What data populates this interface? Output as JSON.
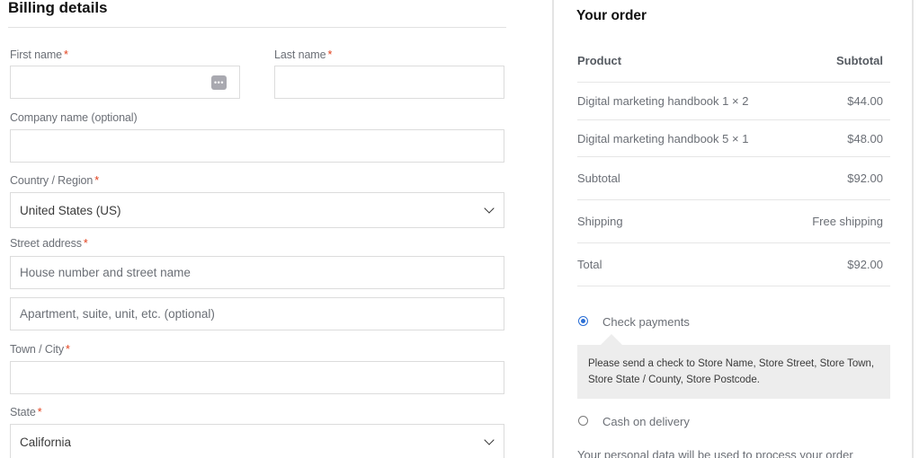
{
  "billing": {
    "title": "Billing details",
    "first_name": {
      "label": "First name",
      "required": "*",
      "value": ""
    },
    "last_name": {
      "label": "Last name",
      "required": "*",
      "value": ""
    },
    "company": {
      "label": "Company name (optional)",
      "value": ""
    },
    "country": {
      "label": "Country / Region",
      "required": "*",
      "selected": "United States (US)"
    },
    "street": {
      "label": "Street address",
      "required": "*",
      "placeholder1": "House number and street name",
      "placeholder2": "Apartment, suite, unit, etc. (optional)"
    },
    "city": {
      "label": "Town / City",
      "required": "*",
      "value": ""
    },
    "state": {
      "label": "State",
      "required": "*",
      "selected": "California"
    },
    "password_icon": "password-manager-icon"
  },
  "order": {
    "title": "Your order",
    "header": {
      "product": "Product",
      "subtotal": "Subtotal"
    },
    "items": [
      {
        "name": "Digital marketing handbook 1 × 2",
        "price": "$44.00"
      },
      {
        "name": "Digital marketing handbook 5 × 1",
        "price": "$48.00"
      }
    ],
    "subtotal": {
      "label": "Subtotal",
      "value": "$92.00"
    },
    "shipping": {
      "label": "Shipping",
      "value": "Free shipping"
    },
    "total": {
      "label": "Total",
      "value": "$92.00"
    },
    "payments": {
      "check": {
        "label": "Check payments",
        "selected": true
      },
      "check_desc": "Please send a check to Store Name, Store Street, Store Town, Store State / County, Store Postcode.",
      "cod": {
        "label": "Cash on delivery",
        "selected": false
      }
    },
    "privacy": "Your personal data will be used to process your order"
  },
  "colors": {
    "required": "#e2401c",
    "radio_accent": "#2b6fd6",
    "notice_bg": "#ededed"
  }
}
